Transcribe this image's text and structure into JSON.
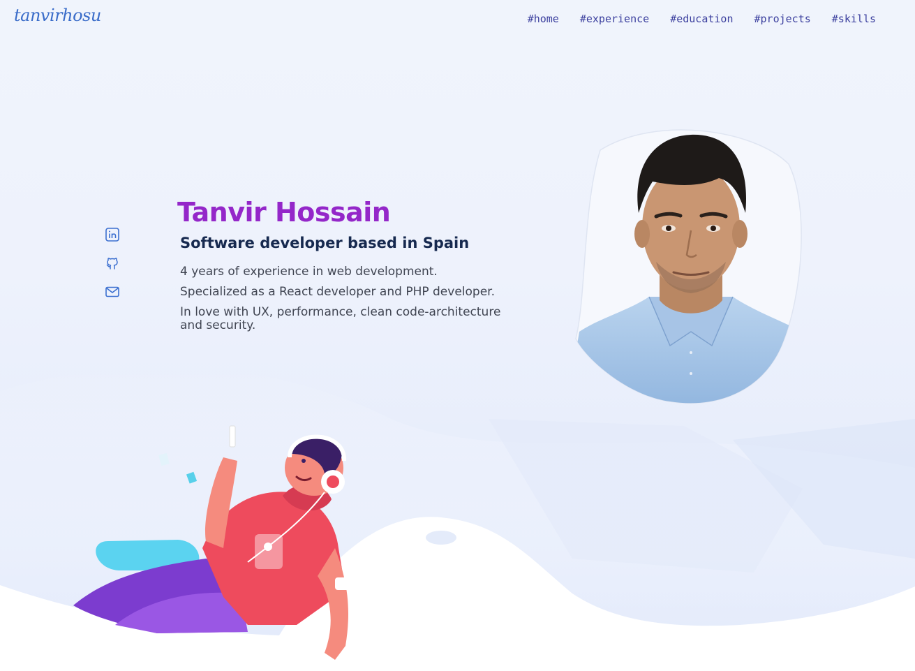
{
  "header": {
    "logo": "tanvirhosu",
    "nav": [
      {
        "label": "#home"
      },
      {
        "label": "#experience"
      },
      {
        "label": "#education"
      },
      {
        "label": "#projects"
      },
      {
        "label": "#skills"
      }
    ]
  },
  "social": [
    {
      "icon": "linkedin-icon"
    },
    {
      "icon": "github-icon"
    },
    {
      "icon": "mail-icon"
    }
  ],
  "hero": {
    "name": "Tanvir Hossain",
    "subtitle": "Software developer based in Spain",
    "lines": [
      "4 years of experience in web development.",
      "Specialized as a React developer and PHP developer.",
      "In love with UX, performance, clean code-architecture and security."
    ]
  },
  "colors": {
    "accent": "#9427c9",
    "nav": "#3b3f9e",
    "logo": "#3a6cc9",
    "icon": "#3b6fd0",
    "subtitle": "#16294f"
  }
}
